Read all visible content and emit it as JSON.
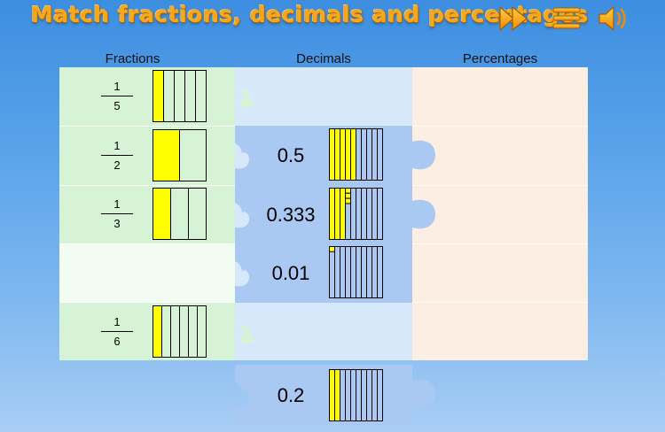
{
  "header": {
    "title": "Match fractions, decimals and percentages",
    "icons": [
      "fast-forward-icon",
      "menu-icon",
      "speaker-icon"
    ]
  },
  "columns": {
    "fractions": "Fractions",
    "decimals": "Decimals",
    "percentages": "Percentages"
  },
  "fraction_rows": [
    {
      "numerator": "1",
      "denominator": "5",
      "parts": 5,
      "shaded": 1
    },
    {
      "numerator": "1",
      "denominator": "2",
      "parts": 2,
      "shaded": 1
    },
    {
      "numerator": "1",
      "denominator": "3",
      "parts": 3,
      "shaded": 1
    },
    null,
    {
      "numerator": "1",
      "denominator": "6",
      "parts": 6,
      "shaded": 1
    }
  ],
  "decimal_pieces": [
    {
      "row": 1,
      "value": "0.5",
      "fill": 0.5
    },
    {
      "row": 2,
      "value": "0.333",
      "fill": 0.333
    },
    {
      "row": 3,
      "value": "0.01",
      "fill": 0.01
    },
    {
      "row": "tray",
      "value": "0.2",
      "fill": 0.2
    }
  ],
  "colors": {
    "accent": "#f7a81b",
    "model_fill": "#ffff00",
    "fraction_bg": "#d6f3d6",
    "decimal_bg": "#d8e8fb",
    "decimal_piece": "#a9c9f2",
    "percentage_bg": "#fdeee3"
  }
}
